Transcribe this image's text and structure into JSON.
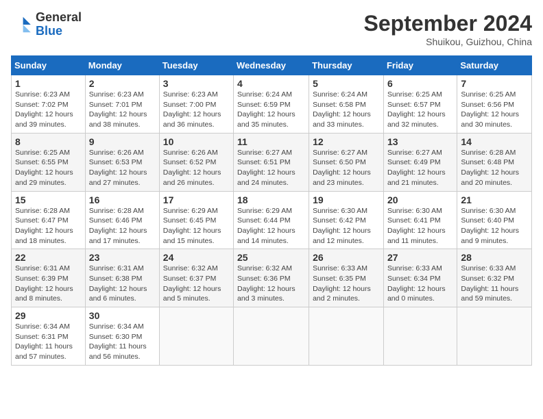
{
  "header": {
    "logo_general": "General",
    "logo_blue": "Blue",
    "month_title": "September 2024",
    "location": "Shuikou, Guizhou, China"
  },
  "weekdays": [
    "Sunday",
    "Monday",
    "Tuesday",
    "Wednesday",
    "Thursday",
    "Friday",
    "Saturday"
  ],
  "weeks": [
    [
      {
        "day": "1",
        "sunrise": "6:23 AM",
        "sunset": "7:02 PM",
        "daylight": "12 hours and 39 minutes."
      },
      {
        "day": "2",
        "sunrise": "6:23 AM",
        "sunset": "7:01 PM",
        "daylight": "12 hours and 38 minutes."
      },
      {
        "day": "3",
        "sunrise": "6:23 AM",
        "sunset": "7:00 PM",
        "daylight": "12 hours and 36 minutes."
      },
      {
        "day": "4",
        "sunrise": "6:24 AM",
        "sunset": "6:59 PM",
        "daylight": "12 hours and 35 minutes."
      },
      {
        "day": "5",
        "sunrise": "6:24 AM",
        "sunset": "6:58 PM",
        "daylight": "12 hours and 33 minutes."
      },
      {
        "day": "6",
        "sunrise": "6:25 AM",
        "sunset": "6:57 PM",
        "daylight": "12 hours and 32 minutes."
      },
      {
        "day": "7",
        "sunrise": "6:25 AM",
        "sunset": "6:56 PM",
        "daylight": "12 hours and 30 minutes."
      }
    ],
    [
      {
        "day": "8",
        "sunrise": "6:25 AM",
        "sunset": "6:55 PM",
        "daylight": "12 hours and 29 minutes."
      },
      {
        "day": "9",
        "sunrise": "6:26 AM",
        "sunset": "6:53 PM",
        "daylight": "12 hours and 27 minutes."
      },
      {
        "day": "10",
        "sunrise": "6:26 AM",
        "sunset": "6:52 PM",
        "daylight": "12 hours and 26 minutes."
      },
      {
        "day": "11",
        "sunrise": "6:27 AM",
        "sunset": "6:51 PM",
        "daylight": "12 hours and 24 minutes."
      },
      {
        "day": "12",
        "sunrise": "6:27 AM",
        "sunset": "6:50 PM",
        "daylight": "12 hours and 23 minutes."
      },
      {
        "day": "13",
        "sunrise": "6:27 AM",
        "sunset": "6:49 PM",
        "daylight": "12 hours and 21 minutes."
      },
      {
        "day": "14",
        "sunrise": "6:28 AM",
        "sunset": "6:48 PM",
        "daylight": "12 hours and 20 minutes."
      }
    ],
    [
      {
        "day": "15",
        "sunrise": "6:28 AM",
        "sunset": "6:47 PM",
        "daylight": "12 hours and 18 minutes."
      },
      {
        "day": "16",
        "sunrise": "6:28 AM",
        "sunset": "6:46 PM",
        "daylight": "12 hours and 17 minutes."
      },
      {
        "day": "17",
        "sunrise": "6:29 AM",
        "sunset": "6:45 PM",
        "daylight": "12 hours and 15 minutes."
      },
      {
        "day": "18",
        "sunrise": "6:29 AM",
        "sunset": "6:44 PM",
        "daylight": "12 hours and 14 minutes."
      },
      {
        "day": "19",
        "sunrise": "6:30 AM",
        "sunset": "6:42 PM",
        "daylight": "12 hours and 12 minutes."
      },
      {
        "day": "20",
        "sunrise": "6:30 AM",
        "sunset": "6:41 PM",
        "daylight": "12 hours and 11 minutes."
      },
      {
        "day": "21",
        "sunrise": "6:30 AM",
        "sunset": "6:40 PM",
        "daylight": "12 hours and 9 minutes."
      }
    ],
    [
      {
        "day": "22",
        "sunrise": "6:31 AM",
        "sunset": "6:39 PM",
        "daylight": "12 hours and 8 minutes."
      },
      {
        "day": "23",
        "sunrise": "6:31 AM",
        "sunset": "6:38 PM",
        "daylight": "12 hours and 6 minutes."
      },
      {
        "day": "24",
        "sunrise": "6:32 AM",
        "sunset": "6:37 PM",
        "daylight": "12 hours and 5 minutes."
      },
      {
        "day": "25",
        "sunrise": "6:32 AM",
        "sunset": "6:36 PM",
        "daylight": "12 hours and 3 minutes."
      },
      {
        "day": "26",
        "sunrise": "6:33 AM",
        "sunset": "6:35 PM",
        "daylight": "12 hours and 2 minutes."
      },
      {
        "day": "27",
        "sunrise": "6:33 AM",
        "sunset": "6:34 PM",
        "daylight": "12 hours and 0 minutes."
      },
      {
        "day": "28",
        "sunrise": "6:33 AM",
        "sunset": "6:32 PM",
        "daylight": "11 hours and 59 minutes."
      }
    ],
    [
      {
        "day": "29",
        "sunrise": "6:34 AM",
        "sunset": "6:31 PM",
        "daylight": "11 hours and 57 minutes."
      },
      {
        "day": "30",
        "sunrise": "6:34 AM",
        "sunset": "6:30 PM",
        "daylight": "11 hours and 56 minutes."
      },
      null,
      null,
      null,
      null,
      null
    ]
  ]
}
